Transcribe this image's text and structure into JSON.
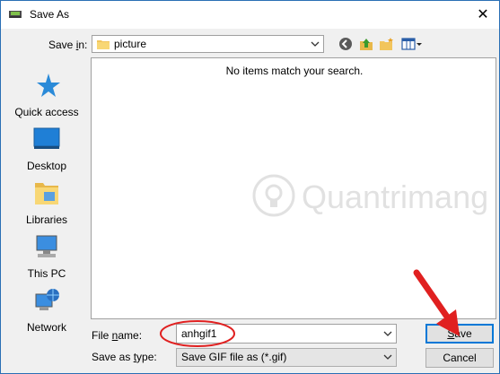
{
  "window": {
    "title": "Save As"
  },
  "toolbar": {
    "save_in_label_pre": "Save ",
    "save_in_label_mnemonic": "i",
    "save_in_label_post": "n:",
    "save_in_value": "picture"
  },
  "places": [
    {
      "label": "Quick access",
      "icon": "star-icon"
    },
    {
      "label": "Desktop",
      "icon": "desktop-icon"
    },
    {
      "label": "Libraries",
      "icon": "libraries-icon"
    },
    {
      "label": "This PC",
      "icon": "computer-icon"
    },
    {
      "label": "Network",
      "icon": "network-icon"
    }
  ],
  "list": {
    "empty_message": "No items match your search."
  },
  "watermark": {
    "text": "Quantrimang"
  },
  "form": {
    "file_name_label_pre": "File ",
    "file_name_label_mnemonic": "n",
    "file_name_label_post": "ame:",
    "file_name_value": "anhgif1",
    "save_type_label_pre": "Save as ",
    "save_type_label_mnemonic": "t",
    "save_type_label_post": "ype:",
    "save_type_value": "Save GIF file as (*.gif)"
  },
  "buttons": {
    "save_mnemonic": "S",
    "save_rest": "ave",
    "cancel": "Cancel"
  },
  "colors": {
    "accent": "#0078d7",
    "annotation": "#e02020"
  }
}
